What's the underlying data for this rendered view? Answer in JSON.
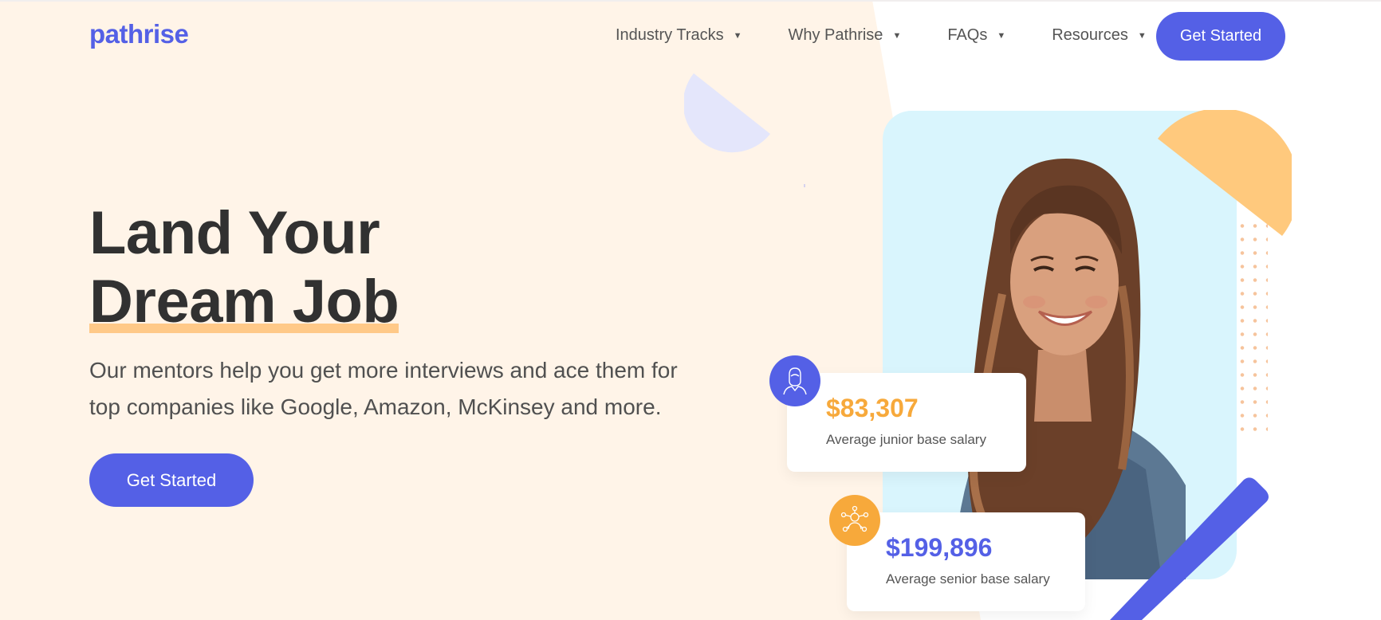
{
  "brand": {
    "logo": "pathrise",
    "accent": "#5460e6",
    "highlight": "#ffc988",
    "orange": "#f7a93b"
  },
  "nav": {
    "items": [
      {
        "label": "Industry Tracks"
      },
      {
        "label": "Why Pathrise"
      },
      {
        "label": "FAQs"
      },
      {
        "label": "Resources"
      }
    ],
    "cta": "Get Started"
  },
  "hero": {
    "title_line1": "Land Your",
    "title_line2": "Dream Job",
    "subtitle": "Our mentors help you get more interviews and ace them for top companies like Google, Amazon, McKinsey and more.",
    "cta": "Get Started"
  },
  "stats": {
    "junior": {
      "amount": "$83,307",
      "label": "Average junior base salary",
      "icon": "woman-profile-icon"
    },
    "senior": {
      "amount": "$199,896",
      "label": "Average senior base salary",
      "icon": "network-people-icon"
    }
  }
}
